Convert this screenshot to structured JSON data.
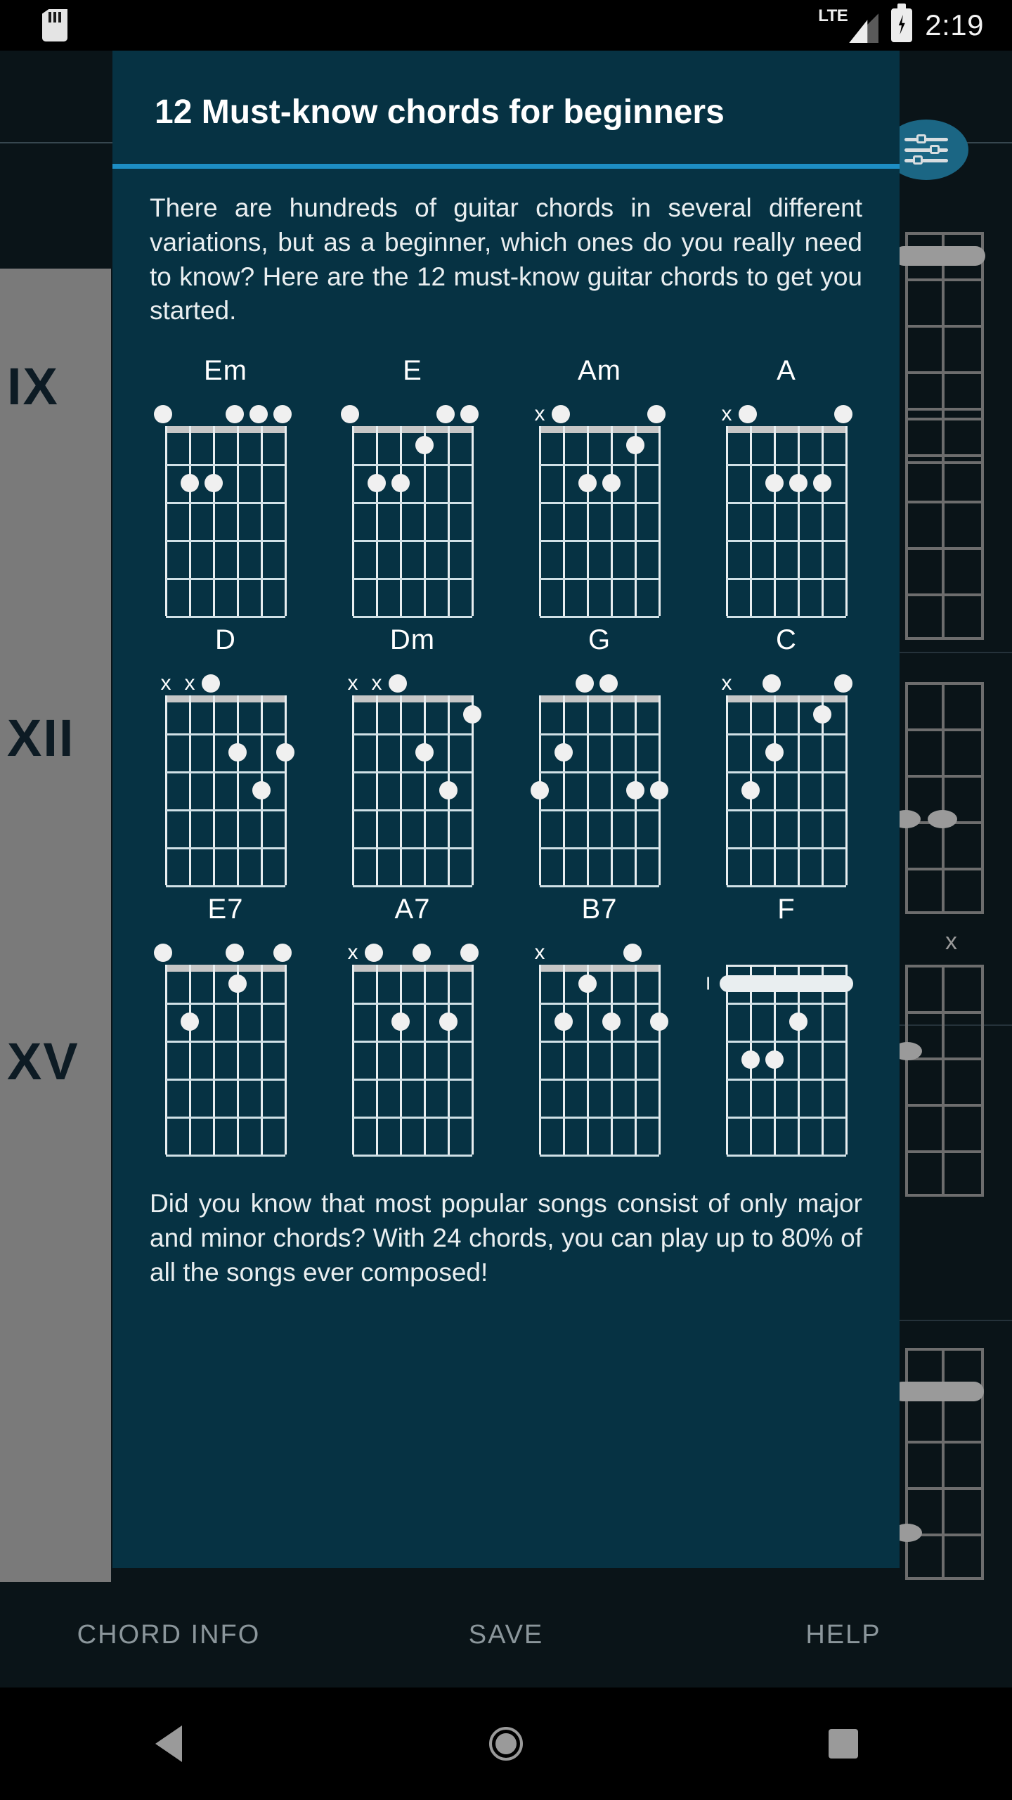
{
  "statusbar": {
    "sd_icon": "sd-card-icon",
    "network_label": "LTE",
    "signal_icon": "signal-bars-icon",
    "battery_icon": "battery-charging-icon",
    "clock": "2:19"
  },
  "background_app": {
    "fab_icon": "sliders-settings-icon",
    "fret_markers": [
      "IX",
      "XII",
      "XV"
    ],
    "muted_marker": "x"
  },
  "dialog": {
    "title": "12 Must-know chords for beginners",
    "accent_color": "#1d8ec4",
    "background_color": "#063243",
    "intro_paragraph": "There are hundreds of guitar chords in several different variations, but as a beginner, which ones do you really need to know? Here are the 12 must-know guitar chords to get you started.",
    "closing_paragraph": "Did you know that most popular songs consist of only major and minor chords? With 24 chords, you can play up to 80% of all the songs ever composed!"
  },
  "chords": [
    {
      "name": "Em",
      "markers": [
        "o",
        "",
        "",
        "o",
        "o",
        "o"
      ],
      "dots": [
        {
          "string": 5,
          "fret": 2
        },
        {
          "string": 4,
          "fret": 2
        }
      ],
      "barre": null,
      "position": null
    },
    {
      "name": "E",
      "markers": [
        "o",
        "",
        "",
        "",
        "o",
        "o"
      ],
      "dots": [
        {
          "string": 3,
          "fret": 1
        },
        {
          "string": 5,
          "fret": 2
        },
        {
          "string": 4,
          "fret": 2
        }
      ],
      "barre": null,
      "position": null
    },
    {
      "name": "Am",
      "markers": [
        "x",
        "o",
        "",
        "",
        "",
        "o"
      ],
      "dots": [
        {
          "string": 2,
          "fret": 1
        },
        {
          "string": 4,
          "fret": 2
        },
        {
          "string": 3,
          "fret": 2
        }
      ],
      "barre": null,
      "position": null
    },
    {
      "name": "A",
      "markers": [
        "x",
        "o",
        "",
        "",
        "",
        "o"
      ],
      "dots": [
        {
          "string": 4,
          "fret": 2
        },
        {
          "string": 3,
          "fret": 2
        },
        {
          "string": 2,
          "fret": 2
        }
      ],
      "barre": null,
      "position": null
    },
    {
      "name": "D",
      "markers": [
        "x",
        "x",
        "o",
        "",
        "",
        ""
      ],
      "dots": [
        {
          "string": 3,
          "fret": 2
        },
        {
          "string": 1,
          "fret": 2
        },
        {
          "string": 2,
          "fret": 3
        }
      ],
      "barre": null,
      "position": null
    },
    {
      "name": "Dm",
      "markers": [
        "x",
        "x",
        "o",
        "",
        "",
        ""
      ],
      "dots": [
        {
          "string": 1,
          "fret": 1
        },
        {
          "string": 3,
          "fret": 2
        },
        {
          "string": 2,
          "fret": 3
        }
      ],
      "barre": null,
      "position": null
    },
    {
      "name": "G",
      "markers": [
        "",
        "",
        "o",
        "o",
        "",
        ""
      ],
      "dots": [
        {
          "string": 5,
          "fret": 2
        },
        {
          "string": 6,
          "fret": 3
        },
        {
          "string": 2,
          "fret": 3
        },
        {
          "string": 1,
          "fret": 3
        }
      ],
      "barre": null,
      "position": null
    },
    {
      "name": "C",
      "markers": [
        "x",
        "",
        "o",
        "",
        "",
        "o"
      ],
      "dots": [
        {
          "string": 2,
          "fret": 1
        },
        {
          "string": 4,
          "fret": 2
        },
        {
          "string": 5,
          "fret": 3
        }
      ],
      "barre": null,
      "position": null
    },
    {
      "name": "E7",
      "markers": [
        "o",
        "",
        "",
        "o",
        "",
        "o"
      ],
      "dots": [
        {
          "string": 3,
          "fret": 1
        },
        {
          "string": 5,
          "fret": 2
        }
      ],
      "barre": null,
      "position": null
    },
    {
      "name": "A7",
      "markers": [
        "x",
        "o",
        "",
        "o",
        "",
        "o"
      ],
      "dots": [
        {
          "string": 4,
          "fret": 2
        },
        {
          "string": 2,
          "fret": 2
        }
      ],
      "barre": null,
      "position": null
    },
    {
      "name": "B7",
      "markers": [
        "x",
        "",
        "",
        "",
        "o",
        ""
      ],
      "dots": [
        {
          "string": 4,
          "fret": 1
        },
        {
          "string": 5,
          "fret": 2
        },
        {
          "string": 3,
          "fret": 2
        },
        {
          "string": 1,
          "fret": 2
        }
      ],
      "barre": null,
      "position": null
    },
    {
      "name": "F",
      "markers": [
        "",
        "",
        "",
        "",
        "",
        ""
      ],
      "dots": [
        {
          "string": 3,
          "fret": 2
        },
        {
          "string": 5,
          "fret": 3
        },
        {
          "string": 4,
          "fret": 3
        }
      ],
      "barre": {
        "fret": 1,
        "from": 6,
        "to": 1
      },
      "position": "I"
    }
  ],
  "bottom_bar": {
    "buttons": [
      "CHORD INFO",
      "SAVE",
      "HELP"
    ]
  },
  "navbar": {
    "back": "back-icon",
    "home": "home-icon",
    "recents": "recents-icon"
  }
}
